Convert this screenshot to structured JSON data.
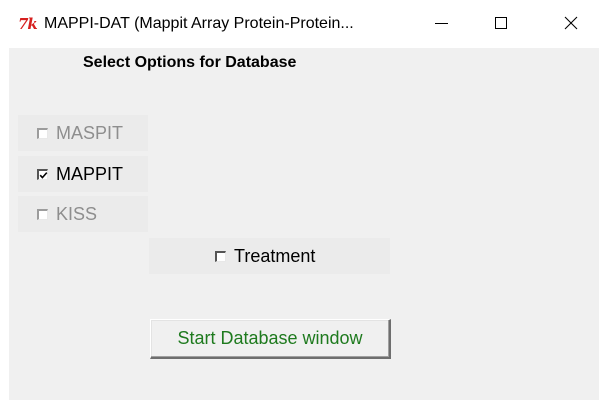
{
  "window": {
    "icon": "tk-feather-icon",
    "title": "MAPPI-DAT (Mappit Array Protein-Protein...",
    "controls": {
      "minimize": "minimize-icon",
      "maximize": "maximize-icon",
      "close": "✕"
    }
  },
  "main": {
    "heading": "Select Options for Database",
    "options": [
      {
        "label": "MASPIT",
        "checked": false,
        "enabled": false
      },
      {
        "label": "MAPPIT",
        "checked": true,
        "enabled": true
      },
      {
        "label": "KISS",
        "checked": false,
        "enabled": false
      }
    ],
    "treatment": {
      "label": "Treatment",
      "checked": false,
      "enabled": true
    },
    "start_button": "Start Database window"
  },
  "colors": {
    "client_bg": "#f0f0f0",
    "disabled_text": "#8e8e8e",
    "button_text": "#1e7a1e",
    "icon_red": "#d6201f"
  }
}
